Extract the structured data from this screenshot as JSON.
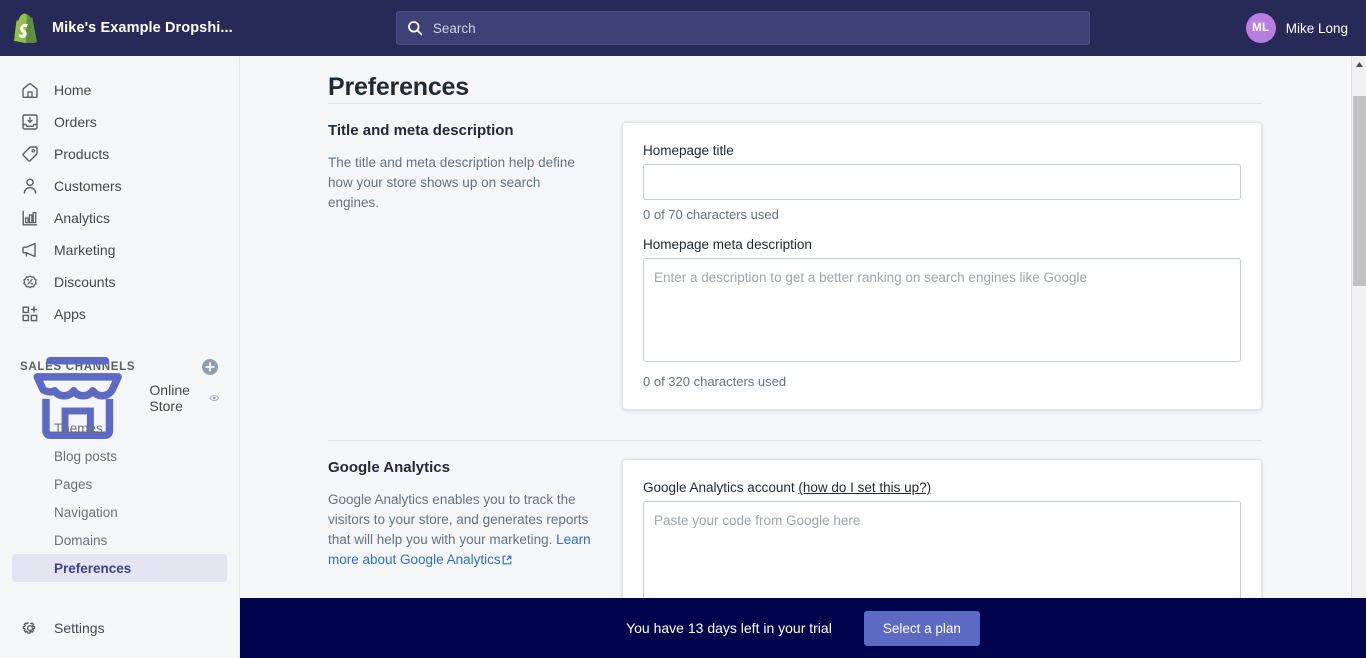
{
  "topbar": {
    "store_name": "Mike's Example Dropshi...",
    "logo_icon": "shopify-bag-icon",
    "search": {
      "icon": "search-icon",
      "placeholder": "Search",
      "value": ""
    },
    "user": {
      "initials": "ML",
      "name": "Mike Long"
    },
    "background_color": "#272a57"
  },
  "sidebar": {
    "items": [
      {
        "label": "Home",
        "icon": "home-icon"
      },
      {
        "label": "Orders",
        "icon": "orders-inbox-icon"
      },
      {
        "label": "Products",
        "icon": "product-tag-icon"
      },
      {
        "label": "Customers",
        "icon": "customer-person-icon"
      },
      {
        "label": "Analytics",
        "icon": "analytics-bar-chart-icon"
      },
      {
        "label": "Marketing",
        "icon": "marketing-megaphone-icon"
      },
      {
        "label": "Discounts",
        "icon": "discount-percent-icon"
      },
      {
        "label": "Apps",
        "icon": "apps-grid-plus-icon"
      }
    ],
    "sales_channels": {
      "title": "SALES CHANNELS",
      "add_icon": "plus-circle-icon",
      "channel": {
        "label": "Online Store",
        "icon": "online-store-icon",
        "preview_icon": "eye-icon"
      },
      "sub_items": [
        {
          "label": "Themes",
          "active": false
        },
        {
          "label": "Blog posts",
          "active": false
        },
        {
          "label": "Pages",
          "active": false
        },
        {
          "label": "Navigation",
          "active": false
        },
        {
          "label": "Domains",
          "active": false
        },
        {
          "label": "Preferences",
          "active": true
        }
      ]
    },
    "settings": {
      "label": "Settings",
      "icon": "gear-icon"
    }
  },
  "main": {
    "page_title": "Preferences",
    "sections": [
      {
        "heading": "Title and meta description",
        "description": "The title and meta description help define how your store shows up on search engines.",
        "fields": {
          "homepage_title_label": "Homepage title",
          "homepage_title_value": "",
          "homepage_title_placeholder": "",
          "homepage_title_helper": "0 of 70 characters used",
          "meta_description_label": "Homepage meta description",
          "meta_description_value": "",
          "meta_description_placeholder": "Enter a description to get a better ranking on search engines like Google",
          "meta_description_helper": "0 of 320 characters used"
        }
      },
      {
        "heading": "Google Analytics",
        "description_prefix": "Google Analytics enables you to track the visitors to your store, and generates reports that will help you with your marketing. ",
        "description_link": "Learn more about Google Analytics",
        "external_link_icon": "external-link-icon",
        "fields": {
          "account_label": "Google Analytics account",
          "account_help_link": "(how do I set this up?)",
          "account_value": "",
          "account_placeholder": "Paste your code from Google here"
        }
      }
    ]
  },
  "scrollbar": {
    "up_icon": "scroll-up-arrow-icon",
    "down_icon": "scroll-down-arrow-icon",
    "thumb": "scrollbar-thumb"
  },
  "trial_banner": {
    "message": "You have 13 days left in your trial",
    "button_label": "Select a plan",
    "background_color": "#00044d",
    "button_color": "#5c6ac4"
  }
}
